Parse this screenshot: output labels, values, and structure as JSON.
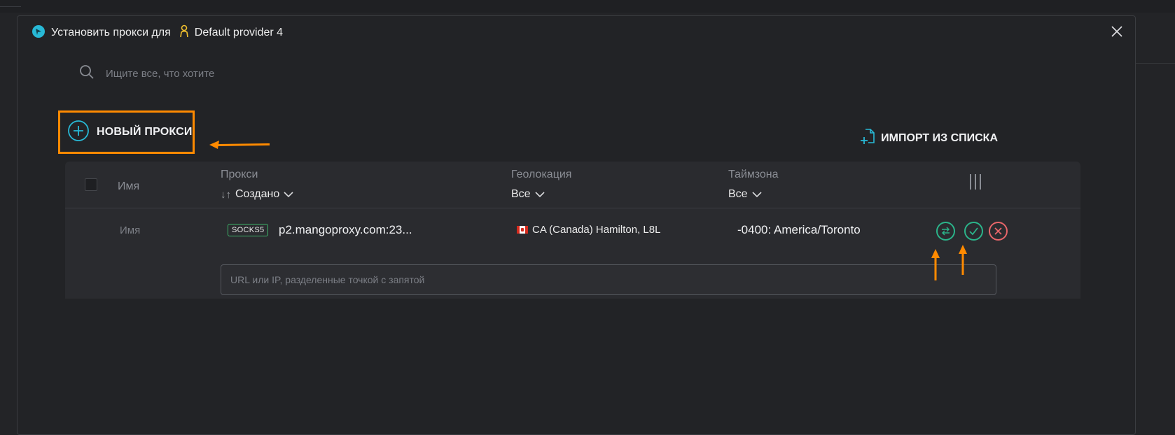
{
  "dialog": {
    "title": "Установить прокси для",
    "provider": "Default provider 4"
  },
  "search": {
    "placeholder": "Ищите все, что хотите"
  },
  "toolbar": {
    "new_proxy_label": "НОВЫЙ ПРОКСИ",
    "import_label": "ИМПОРТ ИЗ СПИСКА"
  },
  "table": {
    "headers": {
      "name": "Имя",
      "proxy": "Прокси",
      "proxy_sort": "Создано",
      "sort_arrows": "↓↑",
      "geo": "Геолокация",
      "geo_filter": "Все",
      "tz": "Таймзона",
      "tz_filter": "Все"
    },
    "rows": [
      {
        "name_placeholder": "Имя",
        "type": "SOCKS5",
        "host": "p2.mangoproxy.com:23...",
        "geo": "CA (Canada) Hamilton, L8L",
        "tz": "-0400: America/Toronto"
      }
    ],
    "url_placeholder": "URL или IP, разделенные точкой с запятой"
  },
  "icons": {
    "app": "app-logo-icon",
    "provider": "person-icon",
    "close": "close-icon",
    "search": "search-icon",
    "add": "plus-circle-icon",
    "import": "file-add-icon",
    "columns": "column-settings-icon",
    "rotate": "rotate-icon",
    "check": "check-icon",
    "remove": "remove-icon"
  },
  "colors": {
    "accent": "#28b9d6",
    "highlight": "#ff8a00",
    "success": "#2bb48a",
    "danger": "#e8666a",
    "provider_icon": "#f2c12e"
  }
}
